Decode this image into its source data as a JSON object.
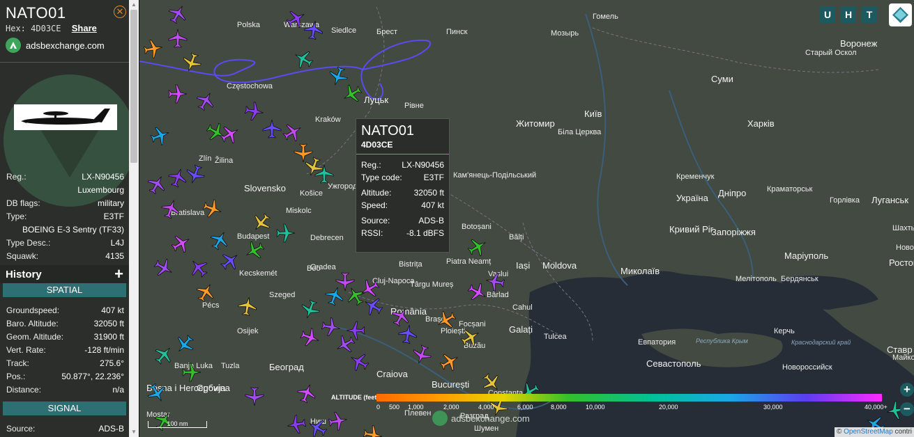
{
  "aircraft": {
    "callsign": "NATO01",
    "hex_label": "Hex:",
    "hex": "4D03CE",
    "share_label": "Share",
    "brand": "adsbexchange.com",
    "close_icon": "close-circle-icon"
  },
  "details": [
    {
      "key": "Reg.:",
      "value": "LX-N90456"
    },
    {
      "key": "",
      "value": "Luxembourg"
    },
    {
      "key": "DB flags:",
      "value": "military"
    },
    {
      "key": "Type:",
      "value": "E3TF"
    },
    {
      "key": "",
      "value": "BOEING E-3 Sentry (TF33)"
    },
    {
      "key": "Type Desc.:",
      "value": "L4J"
    },
    {
      "key": "Squawk:",
      "value": "4135"
    }
  ],
  "history": {
    "label": "History",
    "toggle": "+"
  },
  "spatial": {
    "title": "SPATIAL",
    "rows": [
      {
        "key": "Groundspeed:",
        "value": "407 kt"
      },
      {
        "key": "Baro. Altitude:",
        "value": "32050 ft"
      },
      {
        "key": "Geom. Altitude:",
        "value": "31900 ft"
      },
      {
        "key": "Vert. Rate:",
        "value": "-128 ft/min"
      },
      {
        "key": "Track:",
        "value": "275.6°"
      },
      {
        "key": "Pos.:",
        "value": "50.877°, 22.236°"
      },
      {
        "key": "Distance:",
        "value": "n/a"
      }
    ]
  },
  "signal": {
    "title": "SIGNAL",
    "rows": [
      {
        "key": "Source:",
        "value": "ADS-B"
      }
    ]
  },
  "popup": {
    "callsign": "NATO01",
    "hex": "4D03CE",
    "rows": [
      {
        "key": "Reg.:",
        "value": "LX-N90456"
      },
      {
        "key": "Type code:",
        "value": "E3TF"
      },
      {
        "key": "Altitude:",
        "value": "32050 ft"
      },
      {
        "key": "Speed:",
        "value": "407 kt"
      },
      {
        "key": "Source:",
        "value": "ADS-B"
      },
      {
        "key": "RSSI:",
        "value": "-8.1 dBFS"
      }
    ]
  },
  "toolbar": {
    "u": "U",
    "h": "H",
    "t": "T",
    "layers_icon": "layers-icon"
  },
  "altitude_legend": {
    "label": "ALTITUDE (feet)",
    "ticks": [
      "0",
      "500",
      "1,000",
      "2,000",
      "4,000",
      "6,000",
      "8,000",
      "10,000",
      "20,000",
      "30,000",
      "40,000+"
    ]
  },
  "map": {
    "scale": "100 nm",
    "brand": "adsbexchange.com",
    "zoom_in": "+",
    "zoom_out": "−",
    "attribution_prefix": "©",
    "attribution_link": "OpenStreetMap",
    "attribution_suffix": "contri",
    "labels": [
      {
        "t": "Polska",
        "c": "city"
      },
      {
        "t": "Warszawa",
        "c": "city"
      },
      {
        "t": "Siedlce",
        "c": "city"
      },
      {
        "t": "Брест",
        "c": "city"
      },
      {
        "t": "Пинск",
        "c": "city"
      },
      {
        "t": "Мозырь",
        "c": "city"
      },
      {
        "t": "Гомель",
        "c": "city"
      },
      {
        "t": "Воронеж",
        "c": "big"
      },
      {
        "t": "Старый Оскол",
        "c": "city"
      },
      {
        "t": "Суми",
        "c": "big"
      },
      {
        "t": "Луцьк",
        "c": "big"
      },
      {
        "t": "Рівне",
        "c": "city"
      },
      {
        "t": "Житомир",
        "c": "big"
      },
      {
        "t": "Київ",
        "c": "big"
      },
      {
        "t": "Біла Церква",
        "c": "city"
      },
      {
        "t": "Харків",
        "c": "big"
      },
      {
        "t": "Częstochowa",
        "c": "city"
      },
      {
        "t": "Kraków",
        "c": "city"
      },
      {
        "t": "Žilina",
        "c": "city"
      },
      {
        "t": "Zlín",
        "c": "city"
      },
      {
        "t": "Slovensko",
        "c": "big"
      },
      {
        "t": "Košice",
        "c": "city"
      },
      {
        "t": "Ужгород",
        "c": "city"
      },
      {
        "t": "Кам'янець-Подільський",
        "c": "city"
      },
      {
        "t": "Кременчук",
        "c": "city"
      },
      {
        "t": "Україна",
        "c": "big"
      },
      {
        "t": "Дніпро",
        "c": "big"
      },
      {
        "t": "Краматорськ",
        "c": "city"
      },
      {
        "t": "Горлівка",
        "c": "city"
      },
      {
        "t": "Луганськ",
        "c": "big"
      },
      {
        "t": "Bratislava",
        "c": "city"
      },
      {
        "t": "Miskolc",
        "c": "city"
      },
      {
        "t": "Debrecen",
        "c": "city"
      },
      {
        "t": "Budapest",
        "c": "city"
      },
      {
        "t": "Botoșani",
        "c": "city"
      },
      {
        "t": "Bălți",
        "c": "city"
      },
      {
        "t": "Кривий Ріг",
        "c": "big"
      },
      {
        "t": "Запоріжжя",
        "c": "big"
      },
      {
        "t": "Шахты",
        "c": "city"
      },
      {
        "t": "Новочеркасск",
        "c": "city"
      },
      {
        "t": "Маріуполь",
        "c": "big"
      },
      {
        "t": "Ростов-на-Дону",
        "c": "big"
      },
      {
        "t": "Oradea",
        "c": "city"
      },
      {
        "t": "Bistrița",
        "c": "city"
      },
      {
        "t": "Piatra Neamț",
        "c": "city"
      },
      {
        "t": "Iași",
        "c": "big"
      },
      {
        "t": "Moldova",
        "c": "big"
      },
      {
        "t": "Миколаїв",
        "c": "big"
      },
      {
        "t": "Мелітополь",
        "c": "city"
      },
      {
        "t": "Бердянськ",
        "c": "city"
      },
      {
        "t": "Kecskemét",
        "c": "city"
      },
      {
        "t": "Cluj-Napoca",
        "c": "city"
      },
      {
        "t": "Târgu Mureș",
        "c": "city"
      },
      {
        "t": "Vaslui",
        "c": "city"
      },
      {
        "t": "Bârlad",
        "c": "city"
      },
      {
        "t": "Szeged",
        "c": "city"
      },
      {
        "t": "Pécs",
        "c": "city"
      },
      {
        "t": "Cahul",
        "c": "city"
      },
      {
        "t": "Osijek",
        "c": "city"
      },
      {
        "t": "România",
        "c": "big"
      },
      {
        "t": "Brașov",
        "c": "city"
      },
      {
        "t": "Focșani",
        "c": "city"
      },
      {
        "t": "Galați",
        "c": "big"
      },
      {
        "t": "Tulcea",
        "c": "city"
      },
      {
        "t": "Евпатория",
        "c": "city"
      },
      {
        "t": "Республика Крым",
        "c": "region"
      },
      {
        "t": "Керчь",
        "c": "city"
      },
      {
        "t": "Краснодарский край",
        "c": "region"
      },
      {
        "t": "Ставр",
        "c": "big"
      },
      {
        "t": "Ploiești",
        "c": "city"
      },
      {
        "t": "Buzău",
        "c": "city"
      },
      {
        "t": "Севастополь",
        "c": "big"
      },
      {
        "t": "Новороссийск",
        "c": "city"
      },
      {
        "t": "Майко",
        "c": "city"
      },
      {
        "t": "Banja Luka",
        "c": "city"
      },
      {
        "t": "Tuzla",
        "c": "city"
      },
      {
        "t": "Београд",
        "c": "big"
      },
      {
        "t": "Craiova",
        "c": "big"
      },
      {
        "t": "București",
        "c": "big"
      },
      {
        "t": "Constanța",
        "c": "city"
      },
      {
        "t": "Bosna i Hercegovina",
        "c": "big"
      },
      {
        "t": "Србија",
        "c": "big"
      },
      {
        "t": "Плевен",
        "c": "city"
      },
      {
        "t": "Разград",
        "c": "city"
      },
      {
        "t": "Шумен",
        "c": "city"
      },
      {
        "t": "Mostar",
        "c": "city"
      },
      {
        "t": "Ниш",
        "c": "city"
      },
      {
        "t": "Boo",
        "c": "city"
      }
    ]
  },
  "colors": {
    "sidebar_bg": "#2b2e2b",
    "section_bg": "#2d6f72",
    "button_bg": "#1d5a5f",
    "track_line": "#6a4dff",
    "brand_green": "#3fa55d"
  }
}
